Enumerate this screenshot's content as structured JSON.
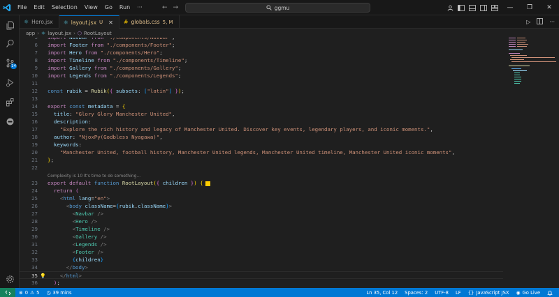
{
  "titlebar": {
    "menu": [
      "File",
      "Edit",
      "Selection",
      "View",
      "Go",
      "Run",
      "···"
    ],
    "search_text": "ggmu"
  },
  "tabs": [
    {
      "name": "Hero.jsx",
      "status": "",
      "active": false,
      "type": "react"
    },
    {
      "name": "layout.jsx",
      "status": "U",
      "active": true,
      "type": "react"
    },
    {
      "name": "globals.css",
      "status": "5, M",
      "active": false,
      "type": "css"
    }
  ],
  "breadcrumb": [
    "app",
    "layout.jsx",
    "RootLayout"
  ],
  "editor": {
    "codelens": "Complexity is 10 It's time to do something...",
    "line_numbers": [
      "5",
      "6",
      "7",
      "8",
      "9",
      "10",
      "11",
      "12",
      "13",
      "14",
      "15",
      "16",
      "17",
      "18",
      "19",
      "20",
      "21",
      "22",
      "23",
      "24",
      "25",
      "26",
      "27",
      "28",
      "29",
      "30",
      "31",
      "32",
      "33",
      "34",
      "35",
      "36"
    ],
    "lines": {
      "l5": "import Navbar from \"./components/Navbar\";",
      "l6_from": "\"./components/Footer\"",
      "l7_from": "\"./components/Hero\"",
      "l8_from": "\"./components/Timeline\"",
      "l9_from": "\"./components/Gallery\"",
      "l10_from": "\"./components/Legends\"",
      "l6_name": "Footer",
      "l7_name": "Hero",
      "l8_name": "Timeline",
      "l9_name": "Gallery",
      "l10_name": "Legends",
      "l12_str": "\"latin\"",
      "l15_str": "\"Glory Glory Manchester United\"",
      "l17_str": "\"Explore the rich history and legacy of Manchester United. Discover key events, legendary players, and iconic moments.\"",
      "l18_str": "\"NjoxPy(Godbless Nyagawa)\"",
      "l20_str": "\"Manchester United, football history, Manchester United legends, Manchester United timeline, Manchester United iconic moments\"",
      "l25_str": "\"en\""
    }
  },
  "statusbar": {
    "errors": "0",
    "warnings": "5",
    "time": "39 mins",
    "position": "Ln 35, Col 12",
    "spaces": "Spaces: 2",
    "encoding": "UTF-8",
    "eol": "LF",
    "language": "JavaScript JSX",
    "golive": "Go Live"
  },
  "colors": {
    "accent": "#0078d4",
    "keyword": "#c586c0",
    "string": "#ce9178",
    "variable": "#9cdcfe",
    "component": "#4ec9b0"
  }
}
